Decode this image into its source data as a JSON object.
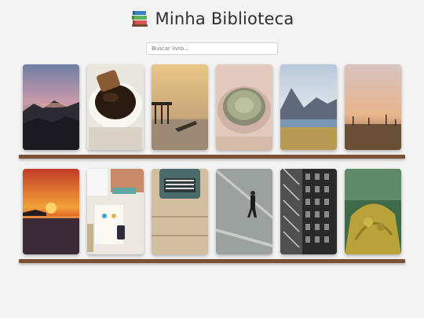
{
  "header": {
    "title": "Minha Biblioteca",
    "icon": "stacked-books-icon"
  },
  "search": {
    "placeholder": "Buscar livro..."
  },
  "shelves": [
    {
      "books": [
        {
          "cover": "mountain-sunset-cover"
        },
        {
          "cover": "coffee-cup-cover"
        },
        {
          "cover": "pier-sunset-cover"
        },
        {
          "cover": "cactus-pot-cover"
        },
        {
          "cover": "lake-mountains-cover"
        },
        {
          "cover": "desert-dusk-cover"
        }
      ]
    },
    {
      "books": [
        {
          "cover": "ocean-sunset-cover"
        },
        {
          "cover": "desk-workspace-cover"
        },
        {
          "cover": "typewriter-cover"
        },
        {
          "cover": "street-walker-cover"
        },
        {
          "cover": "building-facade-cover"
        },
        {
          "cover": "mossy-tree-cover"
        }
      ]
    }
  ],
  "colors": {
    "background": "#f3f3f3",
    "shelf_plank": "#7a5133",
    "title_text": "#2f2f2f"
  }
}
